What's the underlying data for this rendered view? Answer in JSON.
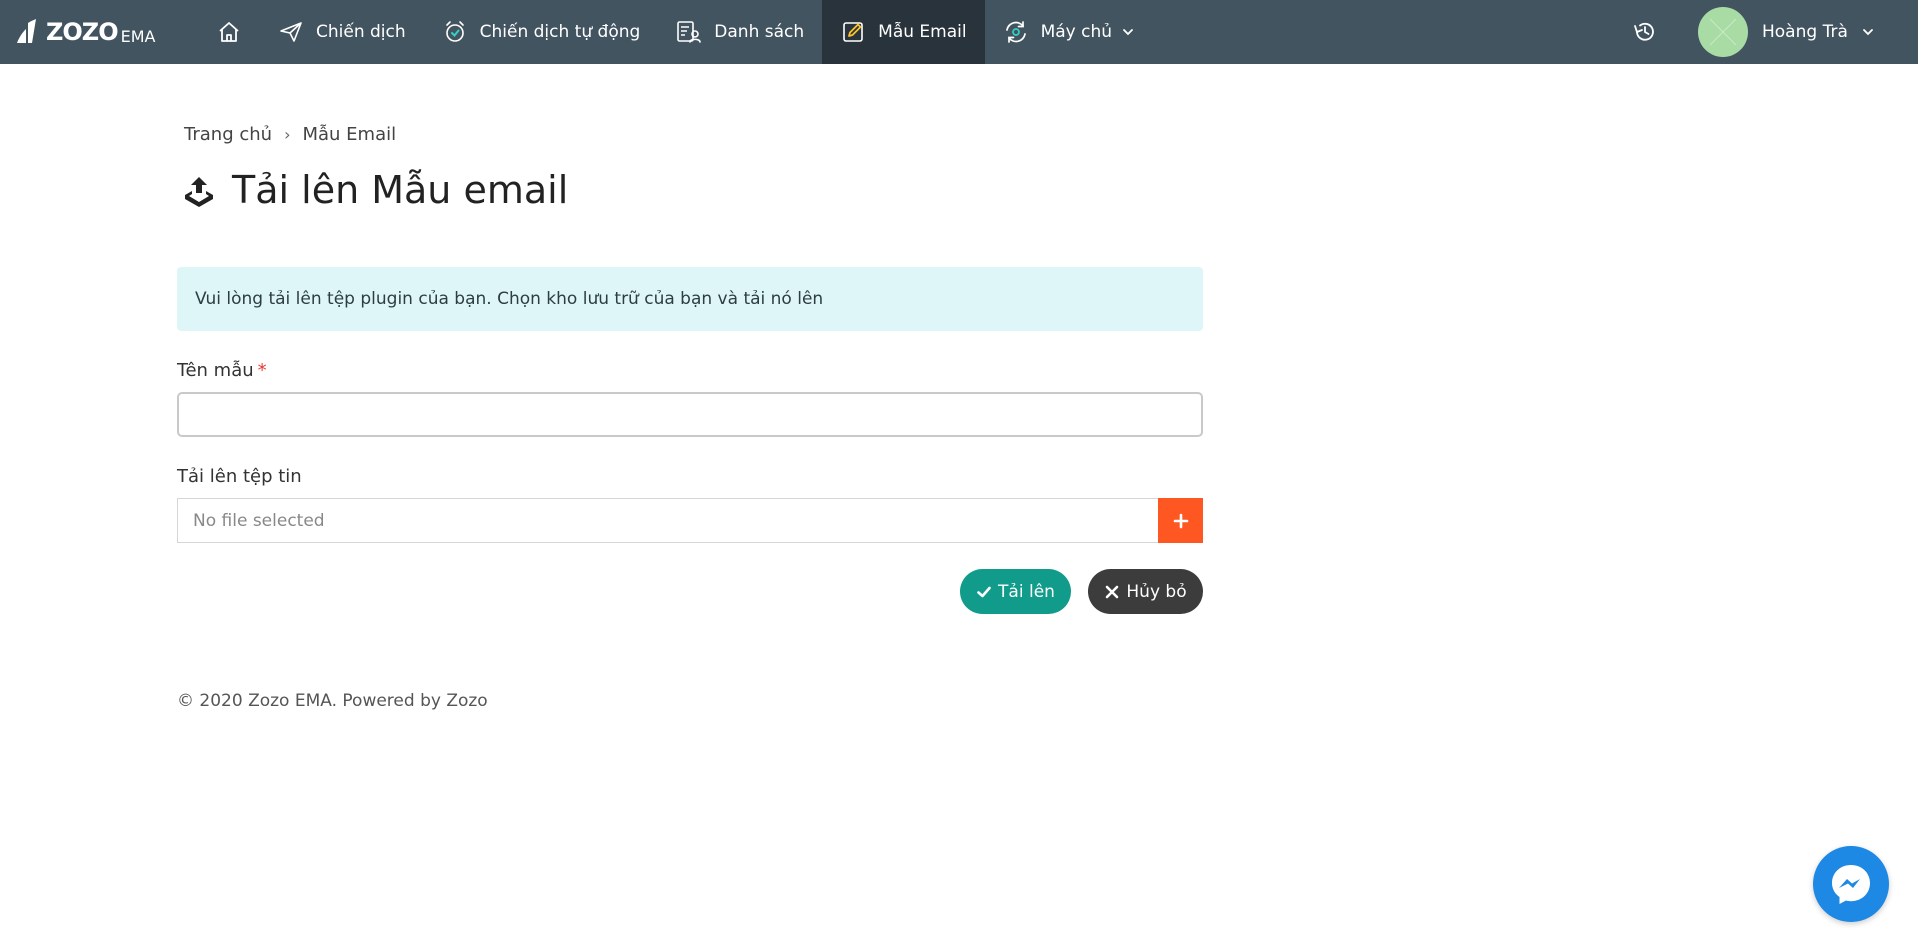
{
  "app": {
    "brand": "ZOZO",
    "brand_sub": "EMA"
  },
  "nav": {
    "home_icon": "home-icon",
    "items": [
      {
        "label": "Chiến dịch",
        "icon": "paper-plane-icon"
      },
      {
        "label": "Chiến dịch tự động",
        "icon": "alarm-clock-icon"
      },
      {
        "label": "Danh sách",
        "icon": "contact-list-icon"
      },
      {
        "label": "Mẫu Email",
        "icon": "edit-template-icon",
        "active": true
      },
      {
        "label": "Máy chủ",
        "icon": "server-sync-icon",
        "dropdown": true
      }
    ]
  },
  "user": {
    "name": "Hoàng Trà"
  },
  "breadcrumb": {
    "home": "Trang chủ",
    "separator": "›",
    "current": "Mẫu Email"
  },
  "page": {
    "title": "Tải lên Mẫu email"
  },
  "alert": {
    "text": "Vui lòng tải lên tệp plugin của bạn. Chọn kho lưu trữ của bạn và tải nó lên"
  },
  "form": {
    "name_label": "Tên mẫu",
    "required_mark": "*",
    "name_value": "",
    "file_label": "Tải lên tệp tin",
    "file_placeholder": "No file selected",
    "add_button": "+",
    "upload_button": "Tải lên",
    "cancel_button": "Hủy bỏ"
  },
  "footer": {
    "text": "© 2020 Zozo EMA. Powered by Zozo"
  },
  "colors": {
    "topbar": "#435461",
    "nav_active": "#29333b",
    "alert_bg": "#dff6f8",
    "upload_btn": "#119b8a",
    "cancel_btn": "#3c3c3c",
    "add_btn": "#ff5722",
    "messenger": "#1e88e5",
    "avatar": "#a9dca4"
  }
}
